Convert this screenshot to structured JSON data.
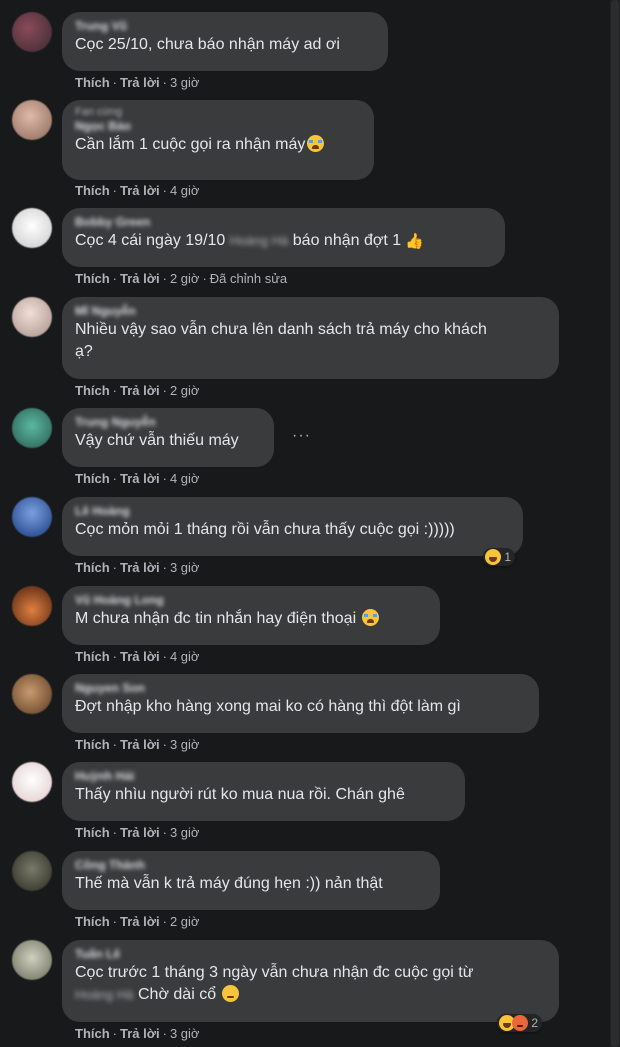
{
  "labels": {
    "like": "Thích",
    "reply": "Trả lời",
    "separator": "·"
  },
  "comments": [
    {
      "author": "Trung Vũ",
      "group": "",
      "text": "Cọc 25/10, chưa báo nhận máy ad ơi",
      "time": "3 giờ",
      "edited": "",
      "avatar_color": "#6b3a4a"
    },
    {
      "author": "Ngọc Bảo",
      "group": "Fan cứng",
      "text": "Cần lắm 1 cuộc gọi ra nhận máy",
      "time": "4 giờ",
      "edited": "",
      "avatar_color": "#c89a8a"
    },
    {
      "author": "Bobby Green",
      "group": "",
      "text_before": "Cọc 4 cái ngày 19/10",
      "text_blurred": "Hoàng Hà",
      "text_after": "báo nhận đợt 1",
      "time": "2 giờ",
      "edited": "Đã chỉnh sửa",
      "avatar_color": "#e4e6eb"
    },
    {
      "author": "Mĩ Nguyễn",
      "group": "",
      "text_line1": "Nhiều vậy sao vẫn chưa lên danh sách trả máy cho khách",
      "text_line2": "ạ?",
      "time": "2 giờ",
      "edited": "",
      "avatar_color": "#d8c8c0"
    },
    {
      "author": "Trung Nguyễn",
      "group": "",
      "text": "Vậy chứ vẫn thiếu máy",
      "time": "4 giờ",
      "edited": "",
      "avatar_color": "#4a9a8a",
      "more": "···"
    },
    {
      "author": "Lê Hoàng",
      "group": "",
      "text": "Cọc mỏn mỏi 1 tháng rồi vẫn chưa thấy cuộc gọi :)))))",
      "time": "3 giờ",
      "edited": "",
      "avatar_color": "#3a6ab0",
      "reaction_count": "1"
    },
    {
      "author": "Vũ Hoàng Long",
      "group": "",
      "text": "M chưa nhận đc tin nhắn hay điện thoại",
      "time": "4 giờ",
      "edited": "",
      "avatar_color": "#c86a3a"
    },
    {
      "author": "Nguyen Son",
      "group": "",
      "text": "Đợt nhập kho hàng xong mai ko có hàng thì đột làm gì",
      "time": "3 giờ",
      "edited": "",
      "avatar_color": "#a07a5a"
    },
    {
      "author": "Huỳnh Hải",
      "group": "",
      "text": "Thấy nhìu người rút ko mua nua rồi. Chán ghê",
      "time": "3 giờ",
      "edited": "",
      "avatar_color": "#f0e0e0"
    },
    {
      "author": "Công Thành",
      "group": "",
      "text": "Thế mà vẫn k trả máy đúng hẹn :)) nản thật",
      "time": "2 giờ",
      "edited": "",
      "avatar_color": "#5a5a4a"
    },
    {
      "author": "Tuấn Lê",
      "group": "",
      "text_line1": "Cọc trước 1 tháng 3 ngày vẫn chưa nhận đc cuộc gọi từ",
      "text_blurred": "Hoàng Hà",
      "text_line2": "Chờ dài cổ",
      "time": "3 giờ",
      "edited": "",
      "avatar_color": "#b0b0a0",
      "reaction_count": "2"
    }
  ]
}
